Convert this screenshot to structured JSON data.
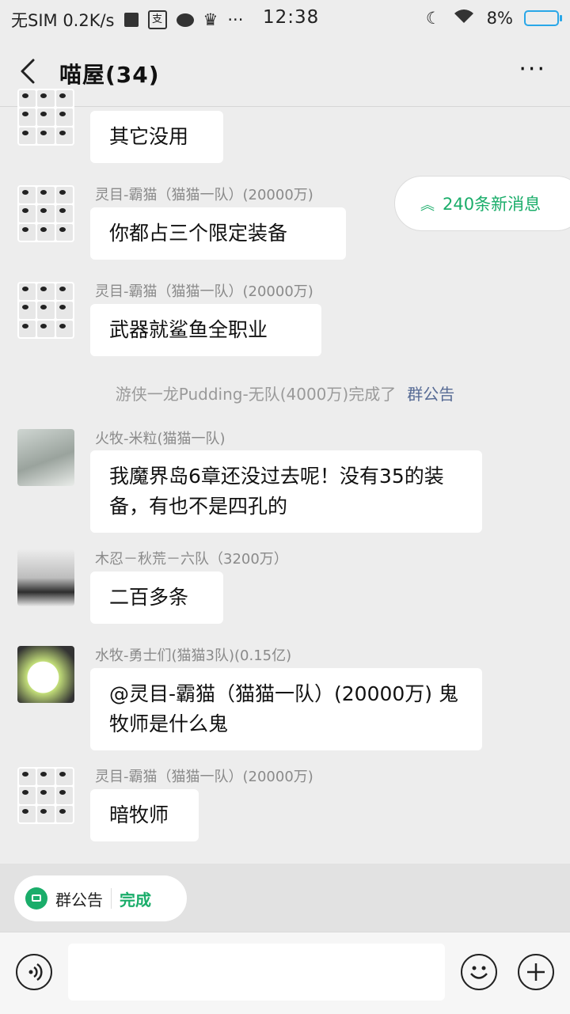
{
  "status_bar": {
    "carrier": "无SIM 0.2K/s",
    "time": "12:38",
    "battery": "8%"
  },
  "header": {
    "title": "喵屋(34)",
    "more": "···"
  },
  "messages": [
    {
      "sender": "",
      "text": "其它没用",
      "avatar": "panda"
    },
    {
      "sender": "灵目-霸猫（猫猫一队）(20000万)",
      "text": "你都占三个限定装备",
      "avatar": "panda"
    },
    {
      "sender": "灵目-霸猫（猫猫一队）(20000万)",
      "text": "武器就鲨鱼全职业",
      "avatar": "panda"
    },
    {
      "sender": "火牧-米粒(猫猫一队)",
      "text": "我魔界岛6章还没过去呢！没有35的装备，有也不是四孔的",
      "avatar": "anime"
    },
    {
      "sender": "木忍－秋荒－六队（3200万）",
      "text": "二百多条",
      "avatar": "photo"
    },
    {
      "sender": "水牧-勇士们(猫猫3队)(0.15亿)",
      "text": "@灵目-霸猫（猫猫一队）(20000万) 鬼牧师是什么鬼",
      "avatar": "cat"
    },
    {
      "sender": "灵目-霸猫（猫猫一队）(20000万)",
      "text": "暗牧师",
      "avatar": "panda"
    }
  ],
  "system_notice": {
    "text": "游侠一龙Pudding-无队(4000万)完成了",
    "link": "群公告"
  },
  "new_messages_chip": {
    "label": "240条新消息",
    "icon": "double-chevron-up-icon"
  },
  "notice_bar": {
    "label": "群公告",
    "action": "完成"
  },
  "colors": {
    "accent_green": "#1aad6a",
    "link_blue": "#576b95",
    "background": "#ededed"
  }
}
